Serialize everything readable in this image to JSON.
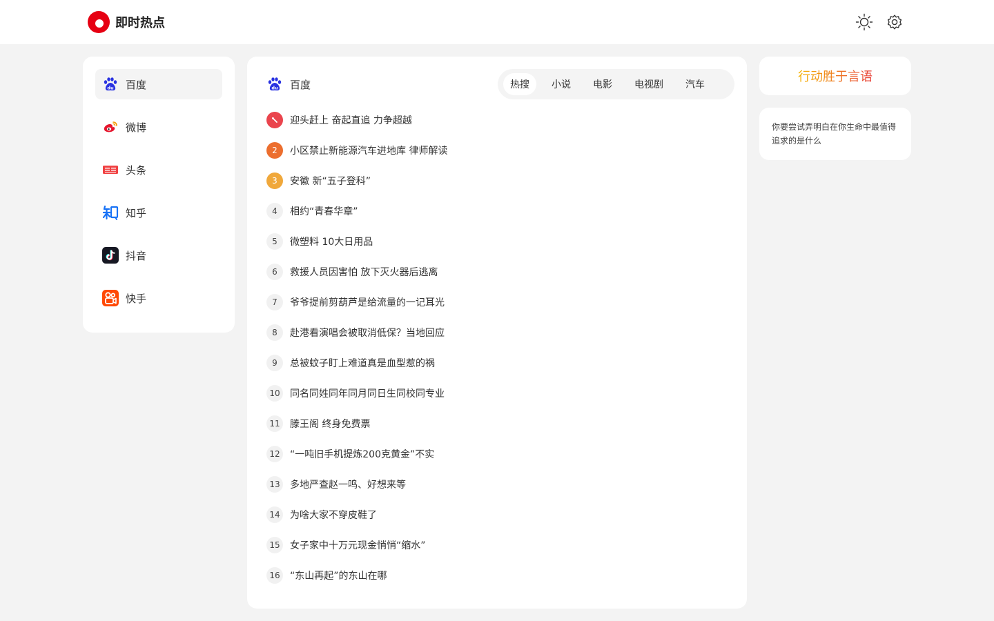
{
  "app": {
    "name": "即时热点"
  },
  "toolbar": {
    "theme_icon": "sun-icon",
    "settings_icon": "gear-icon"
  },
  "sidebar": {
    "items": [
      {
        "label": "百度",
        "icon": "baidu-icon",
        "active": true
      },
      {
        "label": "微博",
        "icon": "weibo-icon",
        "active": false
      },
      {
        "label": "头条",
        "icon": "toutiao-icon",
        "active": false
      },
      {
        "label": "知乎",
        "icon": "zhihu-icon",
        "active": false
      },
      {
        "label": "抖音",
        "icon": "douyin-icon",
        "active": false
      },
      {
        "label": "快手",
        "icon": "kuaishou-icon",
        "active": false
      }
    ]
  },
  "main": {
    "source_title": "百度",
    "tabs": [
      {
        "label": "热搜",
        "active": true
      },
      {
        "label": "小说",
        "active": false
      },
      {
        "label": "电影",
        "active": false
      },
      {
        "label": "电视剧",
        "active": false
      },
      {
        "label": "汽车",
        "active": false
      }
    ],
    "items": [
      {
        "rank": "",
        "title": "迎头赶上 奋起直追 力争超越",
        "pinned": true
      },
      {
        "rank": "2",
        "title": "小区禁止新能源汽车进地库 律师解读"
      },
      {
        "rank": "3",
        "title": "安徽 新“五子登科”"
      },
      {
        "rank": "4",
        "title": "相约“青春华章”"
      },
      {
        "rank": "5",
        "title": "微塑料 10大日用品"
      },
      {
        "rank": "6",
        "title": "救援人员因害怕 放下灭火器后逃离"
      },
      {
        "rank": "7",
        "title": "爷爷提前剪葫芦是给流量的一记耳光"
      },
      {
        "rank": "8",
        "title": "赴港看演唱会被取消低保？当地回应"
      },
      {
        "rank": "9",
        "title": "总被蚊子盯上难道真是血型惹的祸"
      },
      {
        "rank": "10",
        "title": "同名同姓同年同月同日生同校同专业"
      },
      {
        "rank": "11",
        "title": "滕王阁 终身免费票"
      },
      {
        "rank": "12",
        "title": "“一吨旧手机提炼200克黄金”不实"
      },
      {
        "rank": "13",
        "title": "多地严查赵一鸣、好想来等"
      },
      {
        "rank": "14",
        "title": "为啥大家不穿皮鞋了"
      },
      {
        "rank": "15",
        "title": "女子家中十万元现金悄悄“缩水”"
      },
      {
        "rank": "16",
        "title": "“东山再起”的东山在哪"
      }
    ]
  },
  "right": {
    "quote": "行动胜于言语",
    "description": "你要尝试弄明白在你生命中最值得追求的是什么"
  },
  "colors": {
    "brand": "#e60012",
    "rank1": "#ea444d",
    "rank2": "#ec6e2e",
    "rank3": "#f0a83b"
  }
}
